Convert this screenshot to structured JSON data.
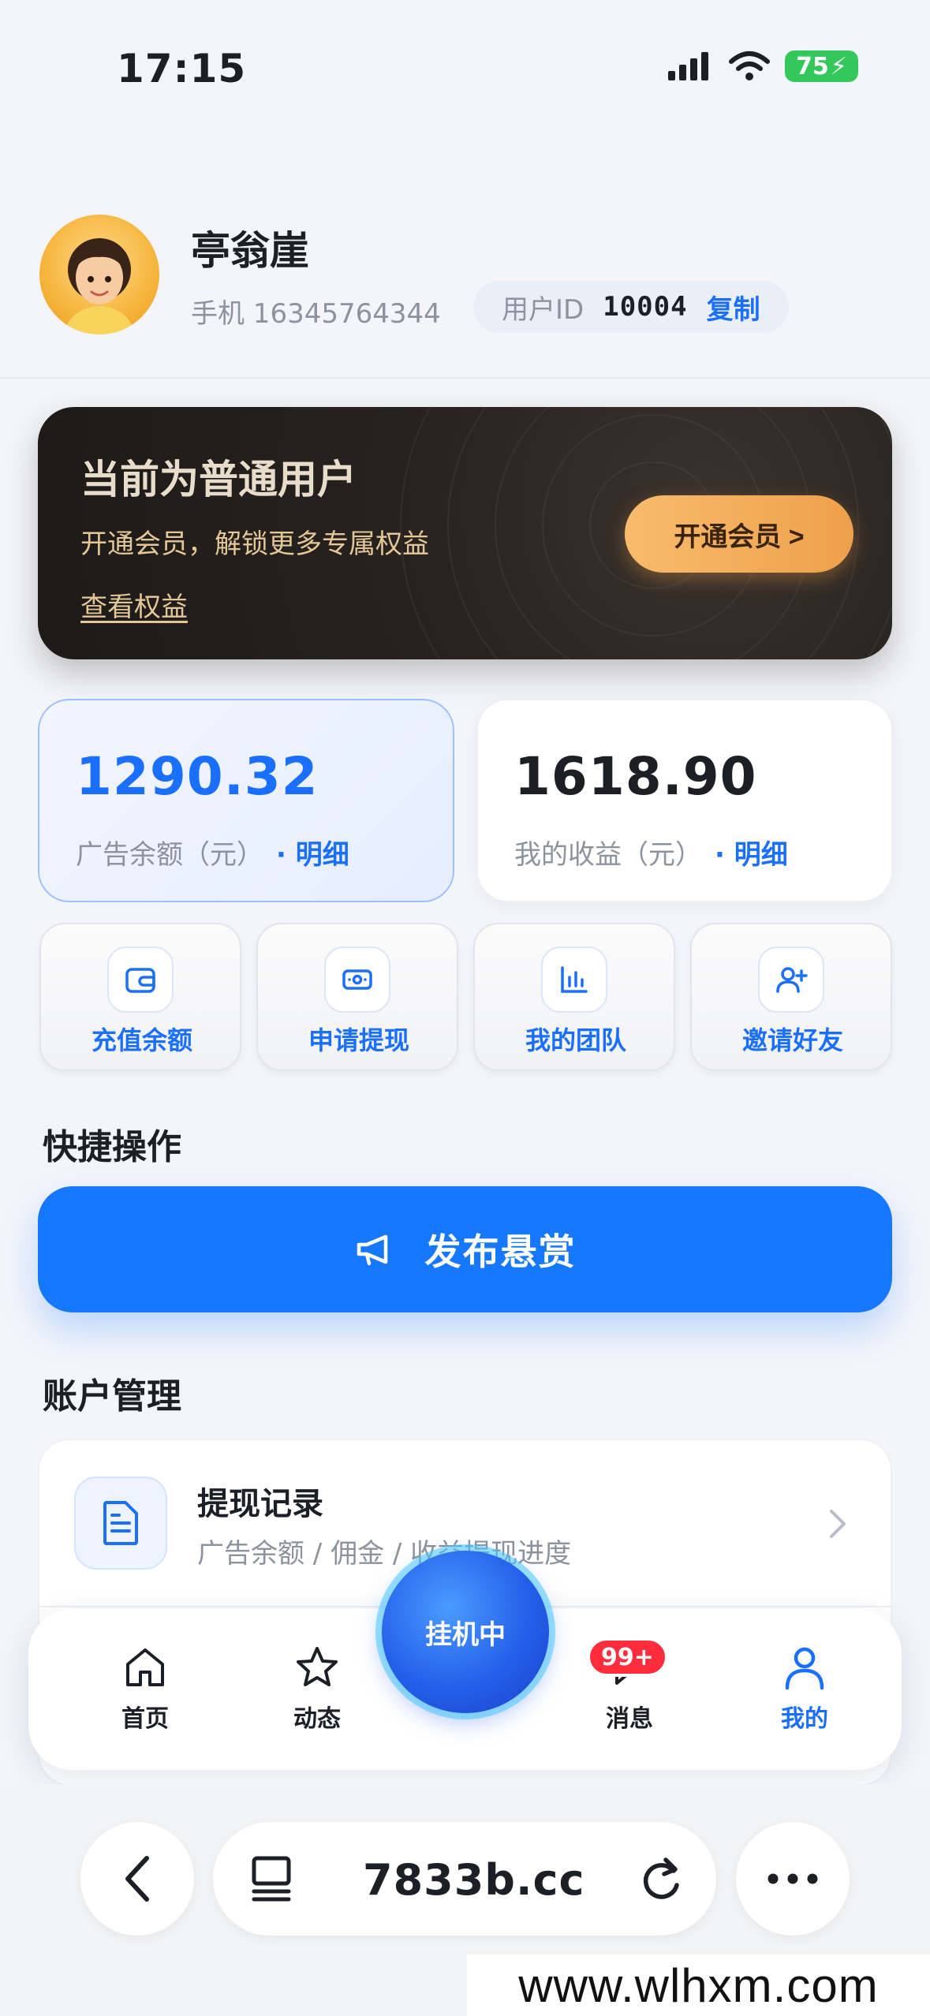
{
  "status_bar": {
    "time": "17:15",
    "battery": "75"
  },
  "profile": {
    "name": "亭翁崖",
    "phone": "手机 16345764344",
    "uid_label": "用户ID",
    "uid_value": "10004",
    "copy_label": "复制"
  },
  "vip": {
    "title": "当前为普通用户",
    "subtitle": "开通会员，解锁更多专属权益",
    "view_link": "查看权益",
    "button": "开通会员 >"
  },
  "balances": [
    {
      "value": "1290.32",
      "label": "广告余额（元）",
      "detail": "· 明细"
    },
    {
      "value": "1618.90",
      "label": "我的收益（元）",
      "detail": "· 明细"
    }
  ],
  "quick_tiles": [
    {
      "label": "充值余额",
      "icon": "wallet-icon"
    },
    {
      "label": "申请提现",
      "icon": "cash-icon"
    },
    {
      "label": "我的团队",
      "icon": "bar-chart-icon"
    },
    {
      "label": "邀请好友",
      "icon": "add-user-icon"
    }
  ],
  "quick_ops": {
    "title": "快捷操作",
    "publish_button": "发布悬赏"
  },
  "account": {
    "title": "账户管理",
    "items": [
      {
        "title": "提现记录",
        "subtitle": "广告余额 / 佣金 / 收益提现进度"
      }
    ]
  },
  "tabbar": {
    "tabs": [
      {
        "label": "首页",
        "icon": "home-icon"
      },
      {
        "label": "动态",
        "icon": "star-icon"
      },
      {
        "label": "消息",
        "icon": "chat-icon"
      },
      {
        "label": "我的",
        "icon": "user-icon"
      }
    ],
    "center_button": "挂机中",
    "message_badge": "99+",
    "active_tab": "我的"
  },
  "browser": {
    "url": "7833b.cc"
  },
  "watermark": "www.wlhxm.com",
  "colors": {
    "accent": "#1a6fff",
    "vip_bg": "#27221f",
    "vip_button": "#f4ad5c",
    "badge": "#ff2d3d"
  }
}
